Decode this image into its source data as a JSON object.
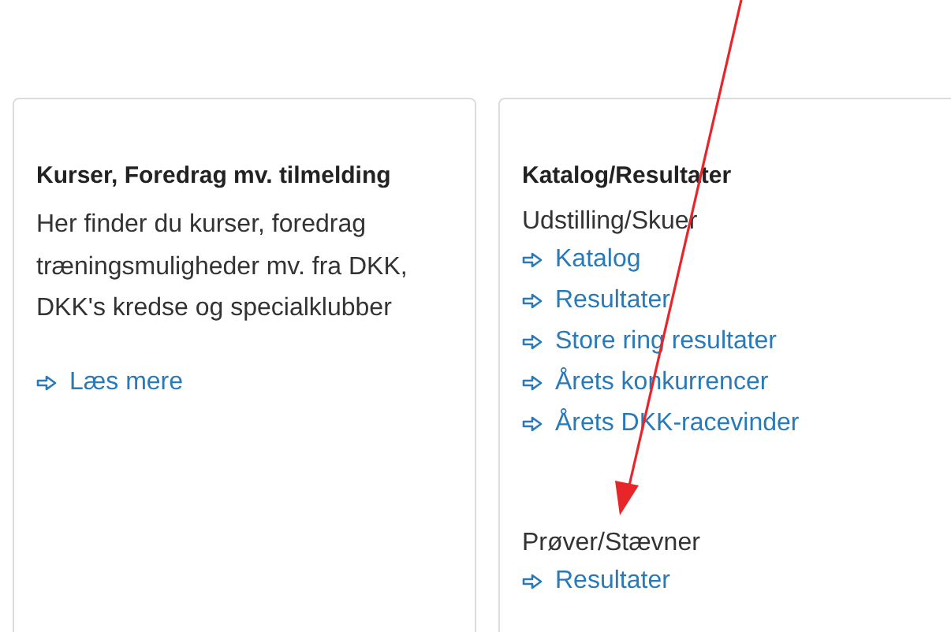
{
  "cards": [
    {
      "kind": "info",
      "title": "Kurser, Foredrag mv. tilmelding",
      "description": "Her finder du kurser, foredrag træningsmuligheder mv. fra DKK, DKK's kredse og specialklubber",
      "links": [
        "Læs mere"
      ]
    },
    {
      "kind": "sections",
      "title": "Katalog/Resultater",
      "sections": [
        {
          "heading": "Udstilling/Skuer",
          "links": [
            "Katalog",
            "Resultater",
            "Store ring resultater",
            "Årets konkurrencer",
            "Årets DKK-racevinder"
          ]
        },
        {
          "heading": "Prøver/Stævner",
          "links": [
            "Resultater"
          ]
        }
      ]
    }
  ]
}
